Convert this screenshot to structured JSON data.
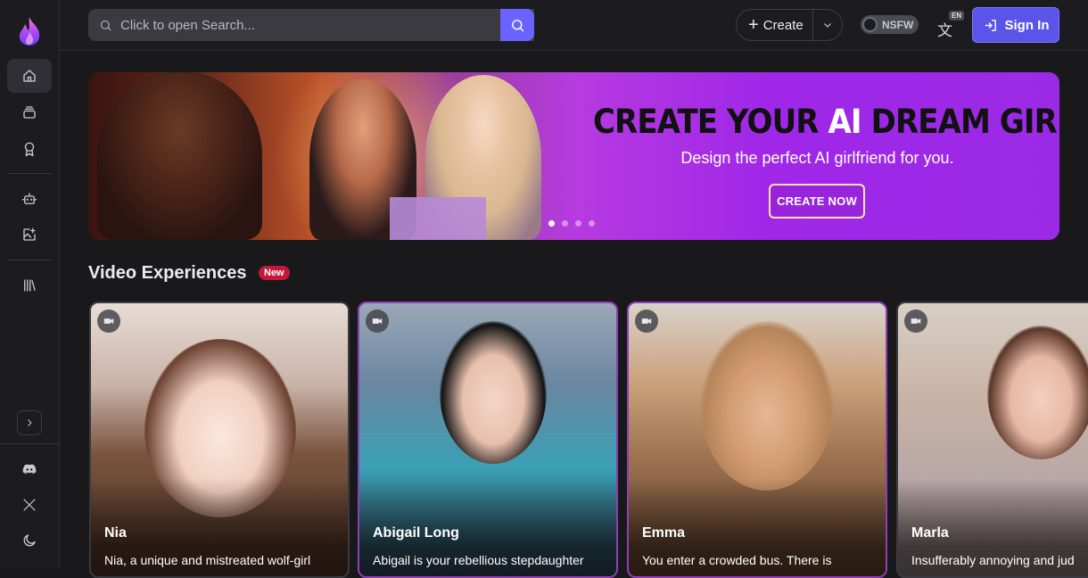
{
  "search": {
    "placeholder": "Click to open Search..."
  },
  "header": {
    "create_label": "Create",
    "nsfw_label": "NSFW",
    "lang_badge": "EN",
    "signin_label": "Sign In"
  },
  "banner": {
    "title_part1": "CREATE YOUR ",
    "title_highlight": "AI",
    "title_part2": " DREAM GIRL",
    "subtitle": "Design the perfect AI girlfriend for you.",
    "cta": "CREATE NOW"
  },
  "section": {
    "title": "Video Experiences",
    "badge": "New"
  },
  "cards": [
    {
      "name": "Nia",
      "desc": "Nia, a unique and mistreated wolf-girl"
    },
    {
      "name": "Abigail Long",
      "desc": "Abigail is your rebellious stepdaughter"
    },
    {
      "name": "Emma",
      "desc": "You enter a crowded bus. There is"
    },
    {
      "name": "Marla",
      "desc": "Insufferably annoying and jud"
    }
  ],
  "colors": {
    "accent": "#6b63ff",
    "badge": "#c2183a",
    "card_selected_border": "#8d3fb7"
  },
  "icons": [
    "flame-logo",
    "home-icon",
    "stack-icon",
    "award-icon",
    "robot-icon",
    "image-plus-icon",
    "library-icon",
    "chevron-right-icon",
    "discord-icon",
    "x-icon",
    "moon-icon",
    "search-icon",
    "plus-icon",
    "chevron-down-icon",
    "translate-icon",
    "sign-in-icon",
    "video-icon"
  ]
}
